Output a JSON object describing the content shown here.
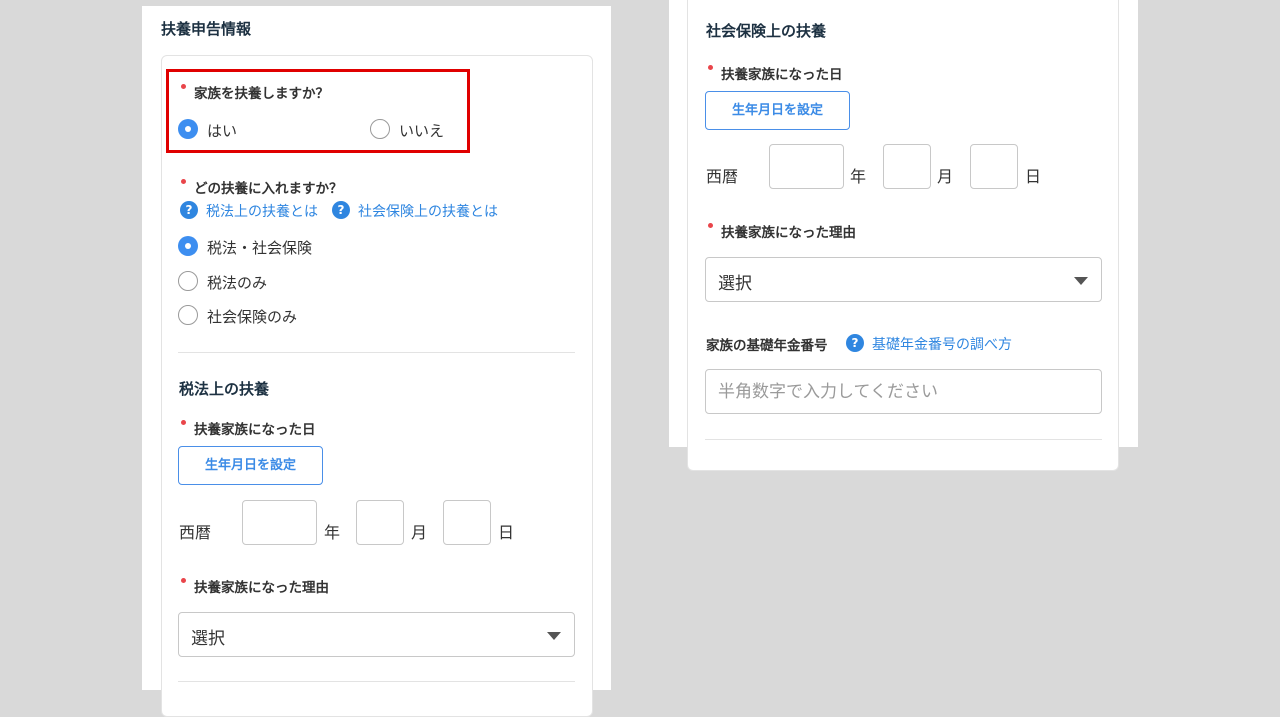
{
  "left": {
    "section_title": "扶養申告情報",
    "q_dependent": {
      "label": "家族を扶養しますか？",
      "options": [
        "はい",
        "いいえ"
      ],
      "selected": "はい"
    },
    "q_type": {
      "label": "どの扶養に入れますか？",
      "help_links": [
        "税法上の扶養とは",
        "社会保険上の扶養とは"
      ],
      "options": [
        "税法・社会保険",
        "税法のみ",
        "社会保険のみ"
      ],
      "selected": "税法・社会保険"
    },
    "tax_section": {
      "title": "税法上の扶養",
      "date_label": "扶養家族になった日",
      "birthdate_button": "生年月日を設定",
      "era": "西暦",
      "year_unit": "年",
      "month_unit": "月",
      "day_unit": "日",
      "reason_label": "扶養家族になった理由",
      "reason_select": "選択"
    }
  },
  "right": {
    "social_section": {
      "title": "社会保険上の扶養",
      "date_label": "扶養家族になった日",
      "birthdate_button": "生年月日を設定",
      "era": "西暦",
      "year_unit": "年",
      "month_unit": "月",
      "day_unit": "日",
      "reason_label": "扶養家族になった理由",
      "reason_select": "選択",
      "pension_label": "家族の基礎年金番号",
      "pension_help_link": "基礎年金番号の調べ方",
      "pension_placeholder": "半角数字で入力してください"
    }
  },
  "colors": {
    "accent": "#3d8ef0",
    "required_dot": "#e9454a",
    "highlight": "#e00000",
    "page_background": "#d9d9d9"
  },
  "icons": {
    "help": "help-circle-icon",
    "caret": "chevron-down-icon"
  }
}
